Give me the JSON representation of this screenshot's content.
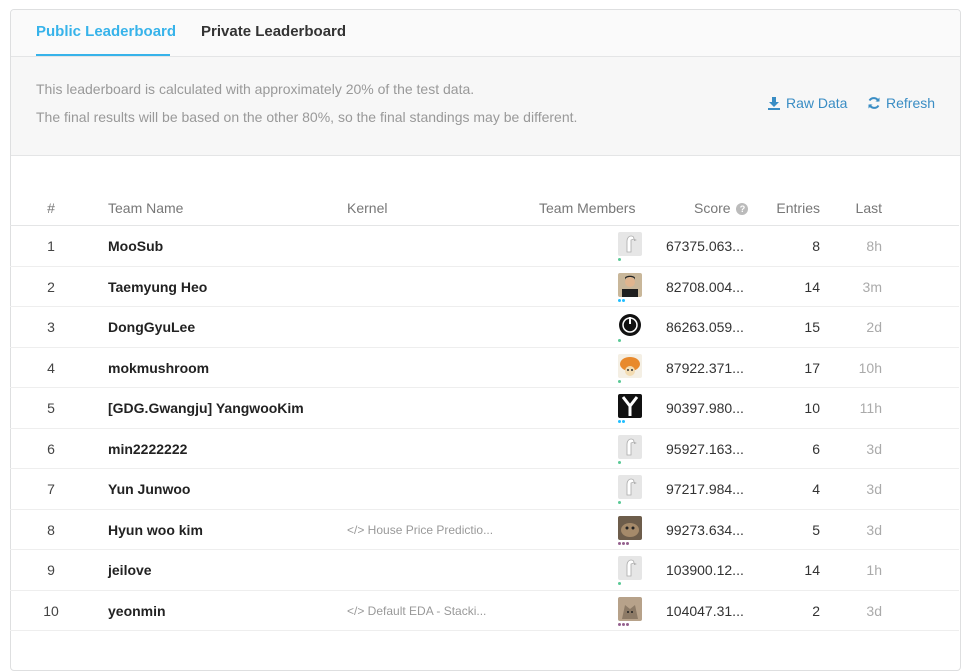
{
  "tabs": {
    "public": "Public Leaderboard",
    "private": "Private Leaderboard"
  },
  "notice": {
    "line1": "This leaderboard is calculated with approximately 20% of the test data.",
    "line2": "The final results will be based on the other 80%, so the final standings may be different."
  },
  "actions": {
    "raw_data": "Raw Data",
    "refresh": "Refresh"
  },
  "columns": {
    "rank": "#",
    "team": "Team Name",
    "kernel": "Kernel",
    "members": "Team Members",
    "score": "Score",
    "entries": "Entries",
    "last": "Last"
  },
  "colors": {
    "accent": "#37b3ea",
    "link": "#3a8dc4"
  },
  "rows": [
    {
      "rank": "1",
      "team": "MooSub",
      "kernel": "",
      "score": "67375.063...",
      "entries": "8",
      "last": "8h",
      "avatar": "default-goose-avatar",
      "tier": "novice"
    },
    {
      "rank": "2",
      "team": "Taemyung Heo",
      "kernel": "",
      "score": "82708.004...",
      "entries": "14",
      "last": "3m",
      "avatar": "person-photo-avatar",
      "tier": "contributor"
    },
    {
      "rank": "3",
      "team": "DongGyuLee",
      "kernel": "",
      "score": "86263.059...",
      "entries": "15",
      "last": "2d",
      "avatar": "round-logo-avatar",
      "tier": "novice"
    },
    {
      "rank": "4",
      "team": "mokmushroom",
      "kernel": "",
      "score": "87922.371...",
      "entries": "17",
      "last": "10h",
      "avatar": "mushroom-avatar",
      "tier": "novice"
    },
    {
      "rank": "5",
      "team": "[GDG.Gwangju] YangwooKim",
      "kernel": "",
      "score": "90397.980...",
      "entries": "10",
      "last": "11h",
      "avatar": "y-logo-avatar",
      "tier": "contributor"
    },
    {
      "rank": "6",
      "team": "min2222222",
      "kernel": "",
      "score": "95927.163...",
      "entries": "6",
      "last": "3d",
      "avatar": "default-goose-avatar",
      "tier": "novice"
    },
    {
      "rank": "7",
      "team": "Yun Junwoo",
      "kernel": "",
      "score": "97217.984...",
      "entries": "4",
      "last": "3d",
      "avatar": "default-goose-avatar",
      "tier": "novice"
    },
    {
      "rank": "8",
      "team": "Hyun woo kim",
      "kernel": "</> House Price Predictio...",
      "score": "99273.634...",
      "entries": "5",
      "last": "3d",
      "avatar": "animal-photo-avatar",
      "tier": "expert"
    },
    {
      "rank": "9",
      "team": "jeilove",
      "kernel": "",
      "score": "103900.12...",
      "entries": "14",
      "last": "1h",
      "avatar": "default-goose-avatar",
      "tier": "novice"
    },
    {
      "rank": "10",
      "team": "yeonmin",
      "kernel": "</> Default EDA - Stacki...",
      "score": "104047.31...",
      "entries": "2",
      "last": "3d",
      "avatar": "cat-photo-avatar",
      "tier": "expert"
    }
  ]
}
